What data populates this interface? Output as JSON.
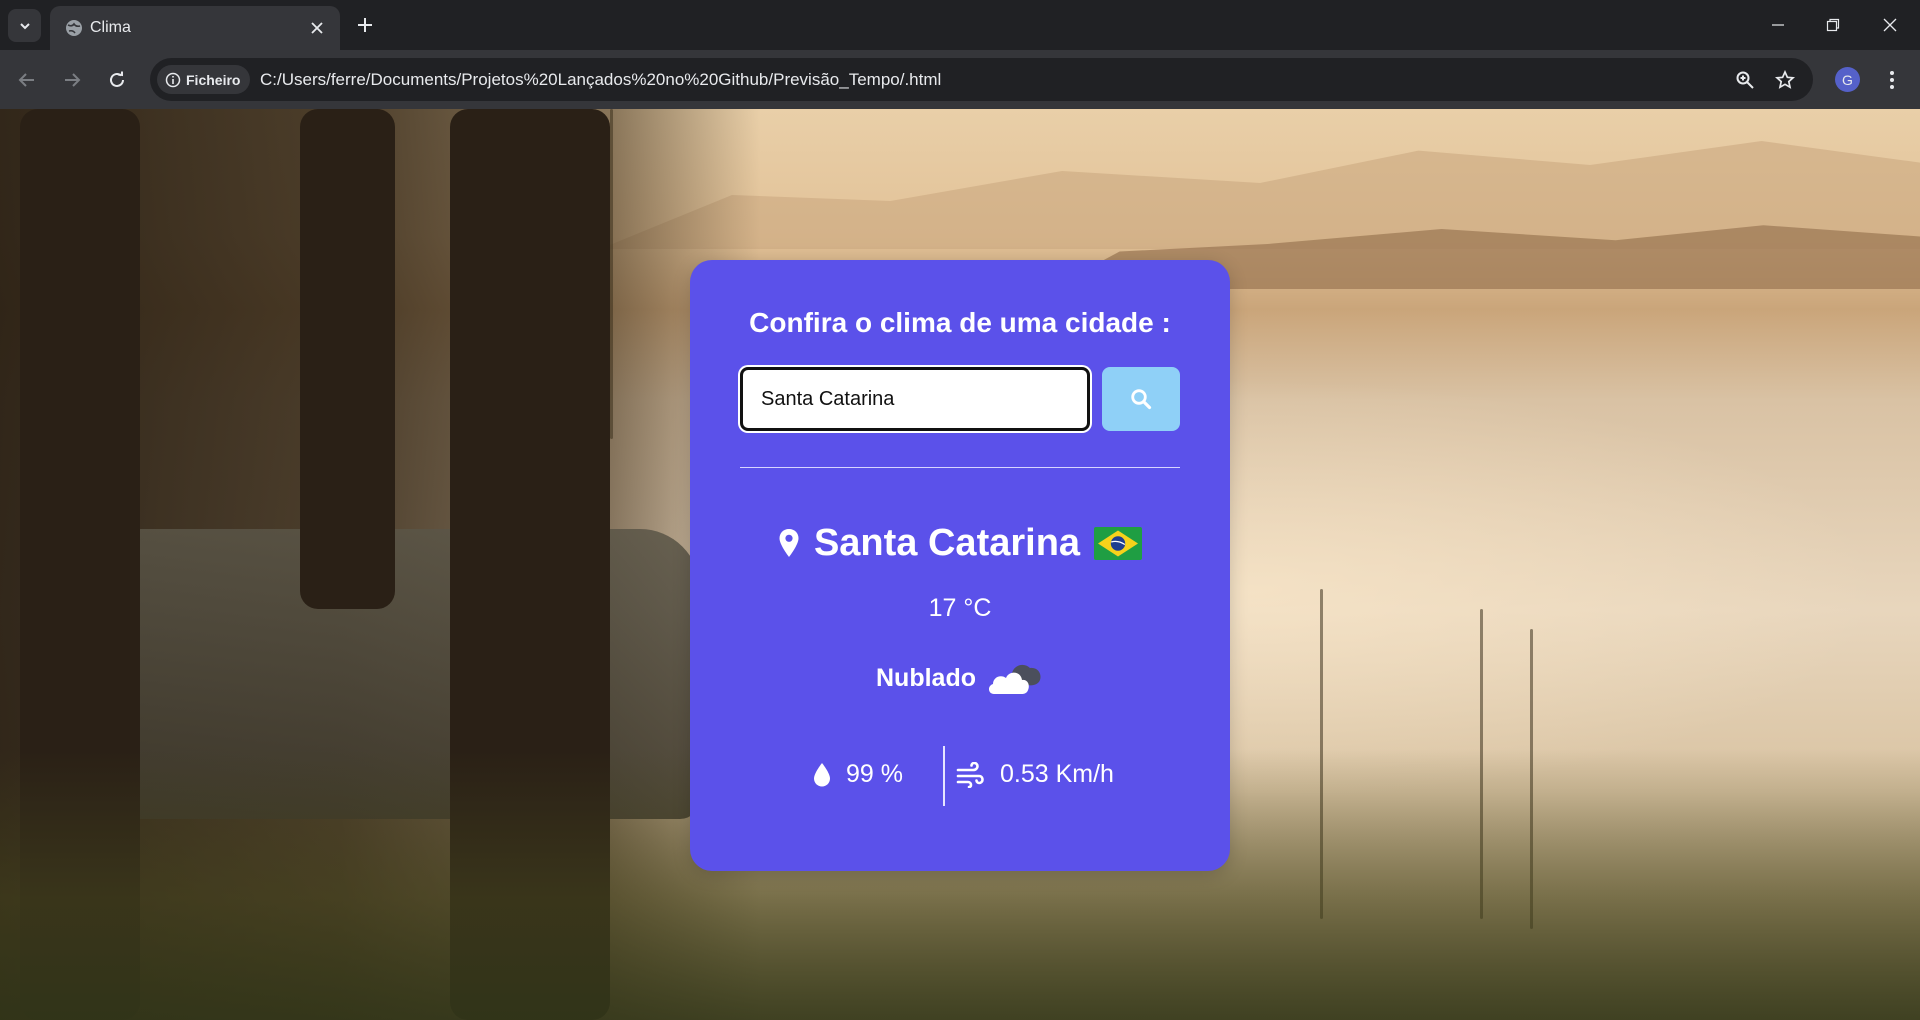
{
  "browser": {
    "tab_title": "Clima",
    "site_chip_label": "Ficheiro",
    "url": "C:/Users/ferre/Documents/Projetos%20Lançados%20no%20Github/Previsão_Tempo/.html",
    "profile_initial": "G"
  },
  "weather_app": {
    "title": "Confira o clima de uma cidade :",
    "search": {
      "value": "Santa Catarina",
      "placeholder": "",
      "button_icon": "search-icon"
    },
    "result": {
      "city": "Santa Catarina",
      "country_flag": "brazil-flag-icon",
      "temperature": "17 °C",
      "condition": "Nublado",
      "condition_icon": "cloud-icon",
      "humidity": "99 %",
      "wind": "0.53 Km/h"
    }
  },
  "colors": {
    "card_background": "#5b51ea",
    "search_button": "#8fd0f7",
    "text": "#ffffff"
  }
}
